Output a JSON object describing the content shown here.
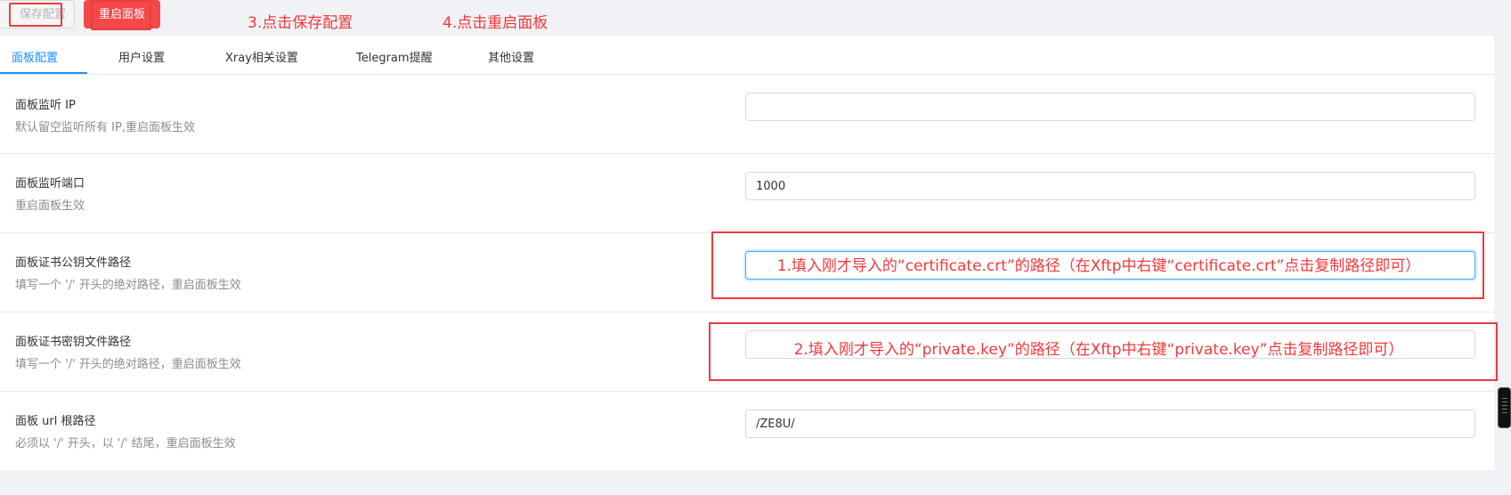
{
  "toolbar": {
    "save_label": "保存配置",
    "restart_label": "重启面板",
    "step3_note": "3.点击保存配置",
    "step4_note": "4.点击重启面板"
  },
  "tabs": [
    {
      "label": "面板配置",
      "active": true
    },
    {
      "label": "用户设置",
      "active": false
    },
    {
      "label": "Xray相关设置",
      "active": false
    },
    {
      "label": "Telegram提醒",
      "active": false
    },
    {
      "label": "其他设置",
      "active": false
    }
  ],
  "settings": [
    {
      "title": "面板监听 IP",
      "desc": "默认留空监听所有 IP,重启面板生效",
      "value": ""
    },
    {
      "title": "面板监听端口",
      "desc": "重启面板生效",
      "value": "1000"
    },
    {
      "title": "面板证书公钥文件路径",
      "desc": "填写一个 '/' 开头的绝对路径，重启面板生效",
      "value": ""
    },
    {
      "title": "面板证书密钥文件路径",
      "desc": "填写一个 '/' 开头的绝对路径，重启面板生效",
      "value": ""
    },
    {
      "title": "面板 url 根路径",
      "desc": "必须以 '/' 开头，以 '/' 结尾，重启面板生效",
      "value": "/ZE8U/"
    }
  ],
  "annotations": {
    "cert_path_note": "1.填入刚才导入的“certificate.crt”的路径（在Xftp中右键“certificate.crt”点击复制路径即可）",
    "key_path_note": "2.填入刚才导入的“private.key”的路径（在Xftp中右键“private.key”点击复制路径即可）"
  },
  "colors": {
    "accent": "#1890ff",
    "danger": "#f5484a",
    "annotation": "#f0393c"
  }
}
